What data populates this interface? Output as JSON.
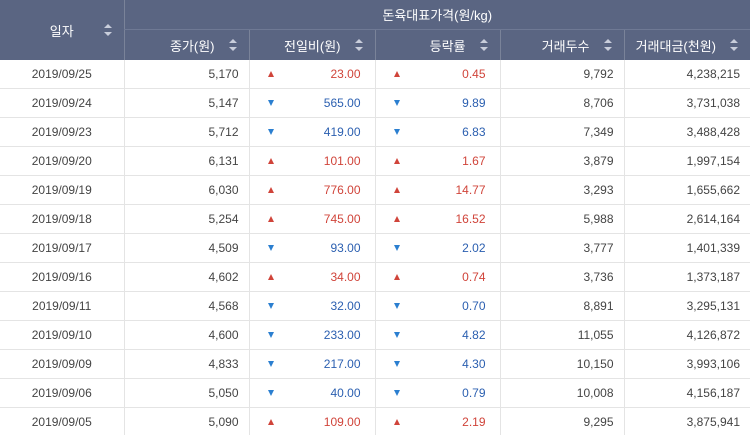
{
  "header": {
    "date_label": "일자",
    "group_title": "돈육대표가격(원/kg)",
    "columns": [
      "종가(원)",
      "전일비(원)",
      "등락률",
      "거래두수",
      "거래대금(천원)"
    ]
  },
  "colors": {
    "header_bg": "#5a6582",
    "up": "#d0443a",
    "down": "#2b5fb0"
  },
  "rows": [
    {
      "date": "2019/09/25",
      "close": "5,170",
      "diff_dir": "up",
      "diff": "23.00",
      "rate_dir": "up",
      "rate": "0.45",
      "volume": "9,792",
      "amount": "4,238,215"
    },
    {
      "date": "2019/09/24",
      "close": "5,147",
      "diff_dir": "down",
      "diff": "565.00",
      "rate_dir": "down",
      "rate": "9.89",
      "volume": "8,706",
      "amount": "3,731,038"
    },
    {
      "date": "2019/09/23",
      "close": "5,712",
      "diff_dir": "down",
      "diff": "419.00",
      "rate_dir": "down",
      "rate": "6.83",
      "volume": "7,349",
      "amount": "3,488,428"
    },
    {
      "date": "2019/09/20",
      "close": "6,131",
      "diff_dir": "up",
      "diff": "101.00",
      "rate_dir": "up",
      "rate": "1.67",
      "volume": "3,879",
      "amount": "1,997,154"
    },
    {
      "date": "2019/09/19",
      "close": "6,030",
      "diff_dir": "up",
      "diff": "776.00",
      "rate_dir": "up",
      "rate": "14.77",
      "volume": "3,293",
      "amount": "1,655,662"
    },
    {
      "date": "2019/09/18",
      "close": "5,254",
      "diff_dir": "up",
      "diff": "745.00",
      "rate_dir": "up",
      "rate": "16.52",
      "volume": "5,988",
      "amount": "2,614,164"
    },
    {
      "date": "2019/09/17",
      "close": "4,509",
      "diff_dir": "down",
      "diff": "93.00",
      "rate_dir": "down",
      "rate": "2.02",
      "volume": "3,777",
      "amount": "1,401,339"
    },
    {
      "date": "2019/09/16",
      "close": "4,602",
      "diff_dir": "up",
      "diff": "34.00",
      "rate_dir": "up",
      "rate": "0.74",
      "volume": "3,736",
      "amount": "1,373,187"
    },
    {
      "date": "2019/09/11",
      "close": "4,568",
      "diff_dir": "down",
      "diff": "32.00",
      "rate_dir": "down",
      "rate": "0.70",
      "volume": "8,891",
      "amount": "3,295,131"
    },
    {
      "date": "2019/09/10",
      "close": "4,600",
      "diff_dir": "down",
      "diff": "233.00",
      "rate_dir": "down",
      "rate": "4.82",
      "volume": "11,055",
      "amount": "4,126,872"
    },
    {
      "date": "2019/09/09",
      "close": "4,833",
      "diff_dir": "down",
      "diff": "217.00",
      "rate_dir": "down",
      "rate": "4.30",
      "volume": "10,150",
      "amount": "3,993,106"
    },
    {
      "date": "2019/09/06",
      "close": "5,050",
      "diff_dir": "down",
      "diff": "40.00",
      "rate_dir": "down",
      "rate": "0.79",
      "volume": "10,008",
      "amount": "4,156,187"
    },
    {
      "date": "2019/09/05",
      "close": "5,090",
      "diff_dir": "up",
      "diff": "109.00",
      "rate_dir": "up",
      "rate": "2.19",
      "volume": "9,295",
      "amount": "3,875,941"
    }
  ]
}
